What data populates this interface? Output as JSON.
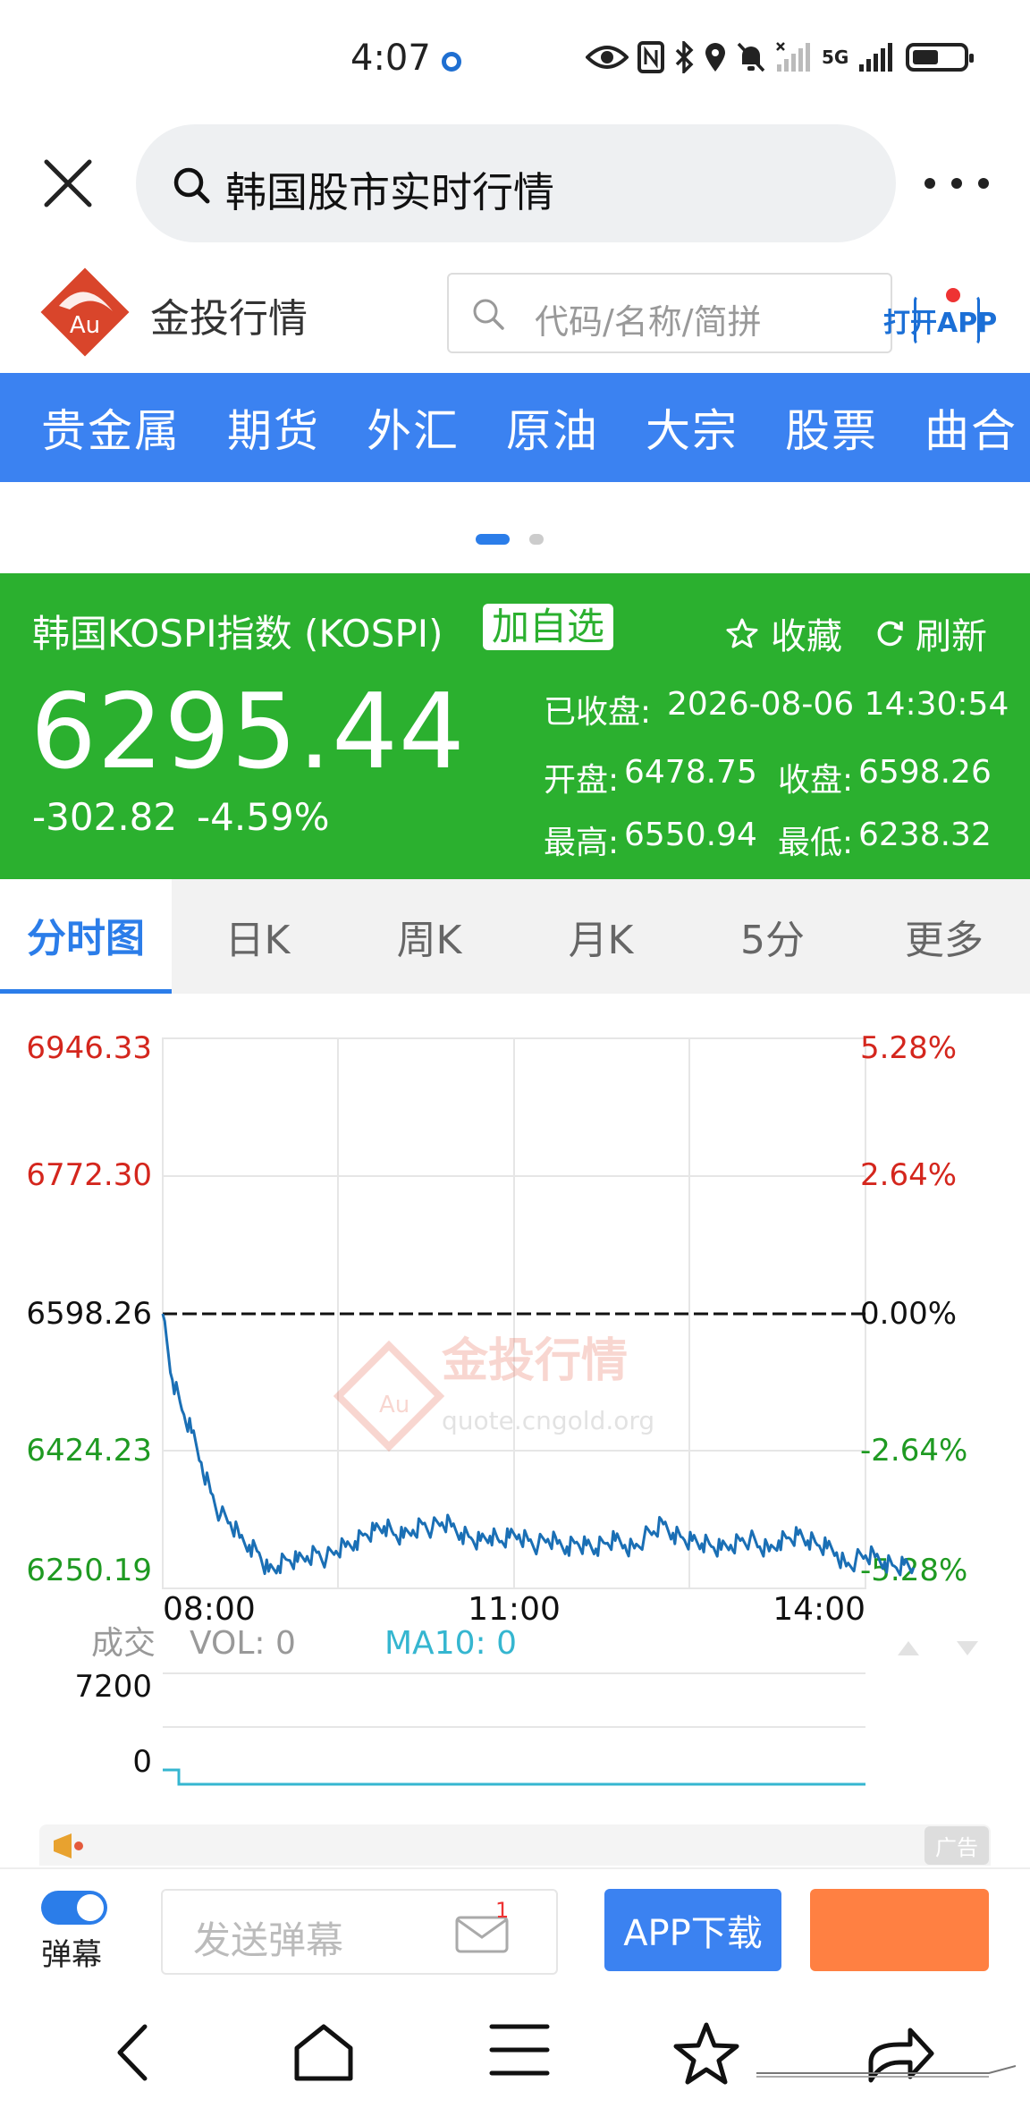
{
  "status_bar": {
    "time": "4:07",
    "network": "5G"
  },
  "browser": {
    "search_query": "韩国股市实时行情"
  },
  "site": {
    "title": "金投行情",
    "logo_text": "Au",
    "search_placeholder": "代码/名称/简拼",
    "open_app_label": "打开APP"
  },
  "nav": {
    "items": [
      "贵金属",
      "期货",
      "外汇",
      "原油",
      "大宗",
      "股票",
      "曲合"
    ]
  },
  "quote": {
    "name": "韩国KOSPI指数 (KOSPI)",
    "add_watchlist_label": "加自选",
    "favorite_label": "收藏",
    "refresh_label": "刷新",
    "price": "6295.44",
    "change": "-302.82",
    "change_pct": "-4.59%",
    "status_label": "已收盘:",
    "status_time": "2026-08-06 14:30:54",
    "open_label": "开盘:",
    "open_value": "6478.75",
    "close_label": "收盘:",
    "close_value": "6598.26",
    "high_label": "最高:",
    "high_value": "6550.94",
    "low_label": "最低:",
    "low_value": "6238.32",
    "colors": {
      "panel": "#2bb02f",
      "up": "#d4261d",
      "down": "#1f9a22"
    }
  },
  "tabs": [
    "分时图",
    "日K",
    "周K",
    "月K",
    "5分",
    "更多"
  ],
  "chart_data": {
    "type": "line",
    "title": "",
    "xlabel": "",
    "ylabel": "",
    "x_ticks": [
      "08:00",
      "11:00",
      "14:00"
    ],
    "y_ticks_left": [
      "6946.33",
      "6772.30",
      "6598.26",
      "6424.23",
      "6250.19"
    ],
    "y_ticks_right": [
      "5.28%",
      "2.64%",
      "0.00%",
      "-2.64%",
      "-5.28%"
    ],
    "ylim": [
      6250.19,
      6946.33
    ],
    "prev_close": 6598.26,
    "watermark_title": "金投行情",
    "watermark_url": "quote.cngold.org",
    "series": [
      {
        "x": [
          "08:00",
          "08:05",
          "08:10",
          "08:15",
          "08:20",
          "08:25",
          "08:30",
          "08:35",
          "08:40",
          "08:45",
          "08:50",
          "08:55",
          "09:00",
          "09:05",
          "09:10",
          "09:15",
          "09:20",
          "09:25",
          "09:30",
          "09:35",
          "09:40",
          "09:45",
          "09:50",
          "09:55",
          "10:00",
          "10:05",
          "10:10",
          "10:15",
          "10:20",
          "10:25",
          "10:30",
          "10:35",
          "10:40",
          "10:45",
          "10:50",
          "10:55",
          "11:00",
          "11:05",
          "11:10",
          "11:15",
          "11:20",
          "11:25",
          "11:30",
          "11:35",
          "11:40",
          "11:45",
          "11:50",
          "11:55",
          "12:00",
          "12:05",
          "12:10",
          "12:15",
          "12:20",
          "12:25",
          "12:30",
          "12:35",
          "12:40",
          "12:45",
          "12:50",
          "12:55",
          "13:00",
          "13:05",
          "13:10",
          "13:15",
          "13:20",
          "13:25",
          "13:30",
          "13:35",
          "13:40",
          "13:45",
          "13:50",
          "13:55",
          "14:00",
          "14:05",
          "14:10",
          "14:15",
          "14:20",
          "14:25",
          "14:30"
        ],
        "values": [
          6598.26,
          6510,
          6470,
          6440,
          6400,
          6360,
          6330,
          6320,
          6300,
          6290,
          6280,
          6255,
          6262,
          6270,
          6268,
          6275,
          6280,
          6272,
          6282,
          6288,
          6295,
          6305,
          6310,
          6315,
          6304,
          6300,
          6310,
          6318,
          6312,
          6320,
          6315,
          6306,
          6300,
          6296,
          6302,
          6294,
          6300,
          6304,
          6296,
          6290,
          6298,
          6292,
          6288,
          6294,
          6290,
          6285,
          6292,
          6296,
          6290,
          6286,
          6300,
          6308,
          6318,
          6306,
          6300,
          6296,
          6292,
          6288,
          6284,
          6290,
          6296,
          6298,
          6288,
          6282,
          6296,
          6300,
          6304,
          6296,
          6290,
          6286,
          6280,
          6262,
          6270,
          6276,
          6274,
          6268,
          6262,
          6264,
          6260
        ]
      }
    ],
    "volume": {
      "label": "成交",
      "vol_label": "VOL: 0",
      "ma10_label": "MA10: 0",
      "y_ticks": [
        "7200",
        "0"
      ]
    }
  },
  "ad": {
    "badge": "广告"
  },
  "danmaku": {
    "toggle_label": "弹幕",
    "input_placeholder": "发送弹幕",
    "mail_badge": "1",
    "app_download_label": "APP下载"
  }
}
